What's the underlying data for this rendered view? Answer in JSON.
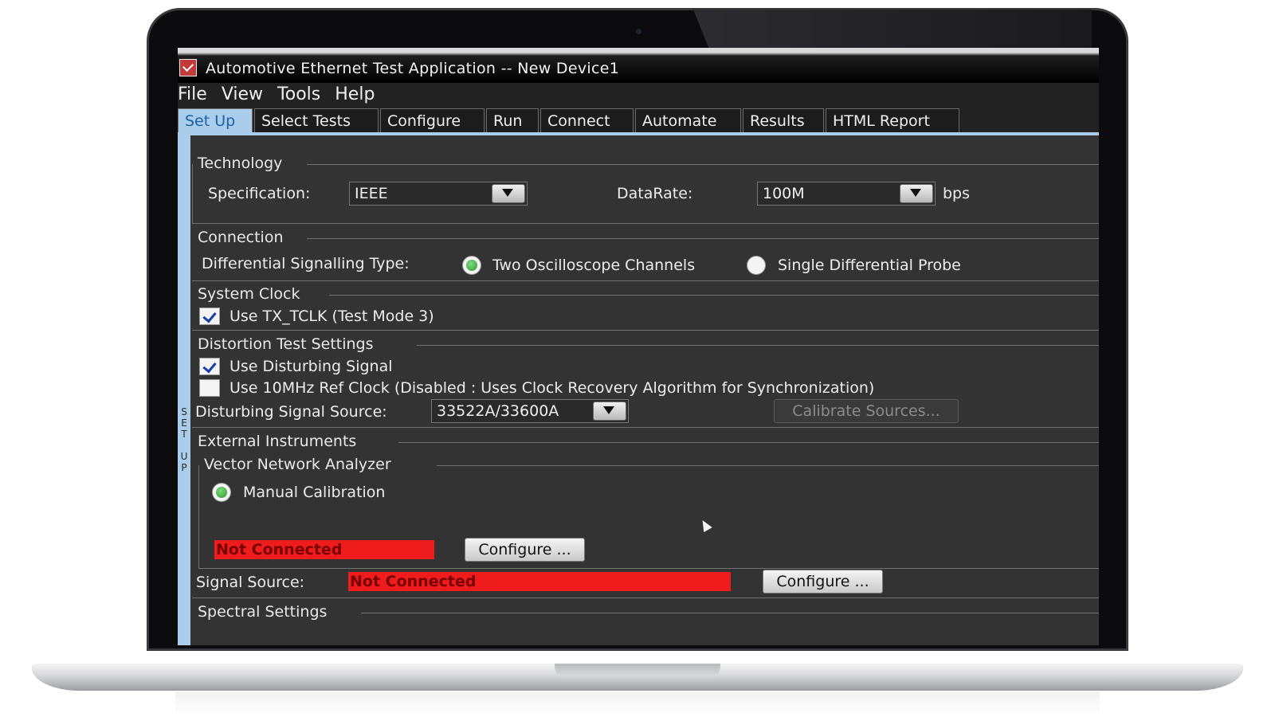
{
  "window": {
    "title": "Automotive Ethernet Test Application -- New Device1"
  },
  "menu": [
    "File",
    "View",
    "Tools",
    "Help"
  ],
  "tabs": [
    "Set Up",
    "Select Tests",
    "Configure",
    "Run",
    "Connect",
    "Automate",
    "Results",
    "HTML Report"
  ],
  "active_tab": "Set Up",
  "side_label": "SET UP",
  "technology": {
    "title": "Technology",
    "spec_label": "Specification:",
    "spec_value": "IEEE",
    "datarate_label": "DataRate:",
    "datarate_value": "100M",
    "datarate_unit": "bps"
  },
  "connection": {
    "title": "Connection",
    "diff_label": "Differential Signalling Type:",
    "option_two": "Two Oscilloscope Channels",
    "option_single": "Single Differential Probe",
    "selected": "Two Oscilloscope Channels"
  },
  "system_clock": {
    "title": "System Clock",
    "use_tx_tclk": "Use TX_TCLK (Test Mode 3)",
    "use_tx_tclk_checked": true
  },
  "distortion": {
    "title": "Distortion Test Settings",
    "use_disturbing": "Use Disturbing Signal",
    "use_disturbing_checked": true,
    "use_ref_clock": "Use 10MHz Ref Clock (Disabled : Uses Clock Recovery Algorithm for Synchronization)",
    "use_ref_clock_checked": false,
    "source_label": "Disturbing Signal Source:",
    "source_value": "33522A/33600A",
    "calibrate_button": "Calibrate Sources..."
  },
  "external": {
    "title": "External Instruments",
    "vna_title": "Vector Network Analyzer",
    "manual_calibration": "Manual Calibration",
    "vna_status": "Not Connected",
    "vna_configure": "Configure ...",
    "signal_source_label": "Signal Source:",
    "signal_source_status": "Not Connected",
    "signal_source_configure": "Configure ..."
  },
  "spectral": {
    "title": "Spectral Settings"
  },
  "colors": {
    "status_red": "#ee1c1c",
    "tab_active": "#a9cdea",
    "panel_bg": "#333333"
  }
}
